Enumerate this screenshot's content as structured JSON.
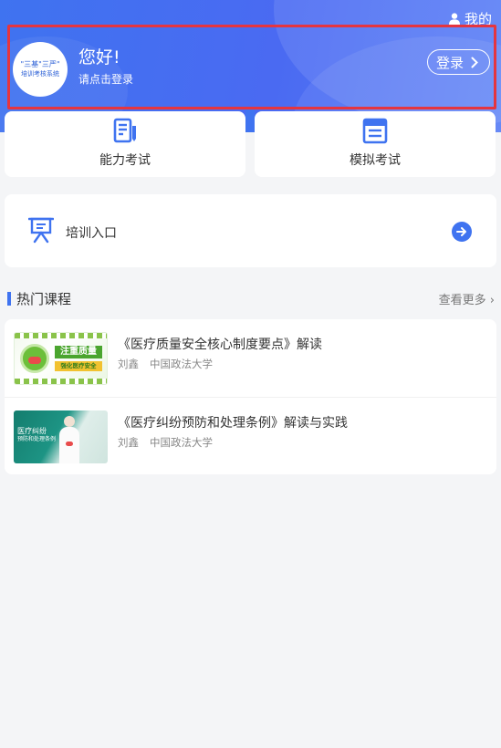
{
  "header": {
    "my_label": "我的",
    "greeting": "您好!",
    "login_hint": "请点击登录",
    "login_button": "登录",
    "avatar_logo_line1": "\"三基\"三严\"",
    "avatar_logo_line2": "培训考核系统"
  },
  "quick_actions": [
    {
      "label": "能力考试",
      "icon": "exam-paper-icon"
    },
    {
      "label": "模拟考试",
      "icon": "document-list-icon"
    }
  ],
  "training": {
    "label": "培训入口",
    "icon": "presentation-board-icon",
    "action_icon": "arrow-right-circle-icon"
  },
  "hot_courses": {
    "title": "热门课程",
    "more_label": "查看更多",
    "items": [
      {
        "title": "《医疗质量安全核心制度要点》解读",
        "lecturer": "刘鑫",
        "institution": "中国政法大学",
        "thumb_text1": "注重质量",
        "thumb_text2": "强化医疗安全"
      },
      {
        "title": "《医疗纠纷预防和处理条例》解读与实践",
        "lecturer": "刘鑫",
        "institution": "中国政法大学",
        "thumb_text1": "医疗纠纷",
        "thumb_text2": "预防和处理条例"
      }
    ]
  },
  "colors": {
    "primary": "#3f73f0",
    "highlight_border": "#e5353f",
    "background": "#f4f5f7"
  }
}
